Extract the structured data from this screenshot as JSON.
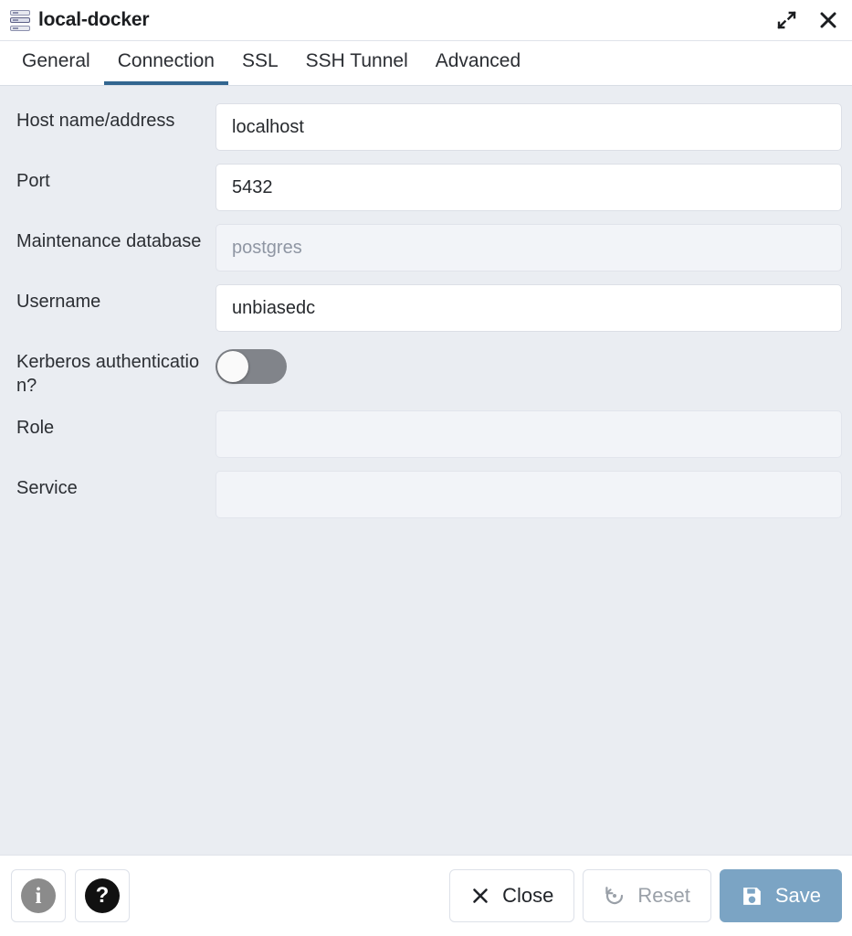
{
  "window": {
    "title": "local-docker",
    "icon": "server-stack-icon",
    "controls": [
      {
        "name": "maximize-button",
        "icon": "expand-diagonal-icon"
      },
      {
        "name": "close-button",
        "icon": "close-x-icon"
      }
    ]
  },
  "tabs": [
    {
      "label": "General",
      "active": false
    },
    {
      "label": "Connection",
      "active": true
    },
    {
      "label": "SSL",
      "active": false
    },
    {
      "label": "SSH Tunnel",
      "active": false
    },
    {
      "label": "Advanced",
      "active": false
    }
  ],
  "form": {
    "host": {
      "label": "Host name/address",
      "value": "localhost",
      "placeholder": ""
    },
    "port": {
      "label": "Port",
      "value": "5432",
      "placeholder": ""
    },
    "maintenance_db": {
      "label": "Maintenance database",
      "value": "",
      "placeholder": "postgres"
    },
    "username": {
      "label": "Username",
      "value": "unbiasedc",
      "placeholder": ""
    },
    "kerberos": {
      "label": "Kerberos authentication?",
      "state": "off"
    },
    "role": {
      "label": "Role",
      "value": "",
      "placeholder": ""
    },
    "service": {
      "label": "Service",
      "value": "",
      "placeholder": ""
    }
  },
  "footer": {
    "info_label": "i",
    "help_label": "?",
    "close_label": "Close",
    "reset_label": "Reset",
    "save_label": "Save"
  },
  "colors": {
    "accent": "#326690",
    "save_button": "#7ba4c4",
    "body_background": "#eaedf2",
    "toggle_off": "#81848a"
  }
}
